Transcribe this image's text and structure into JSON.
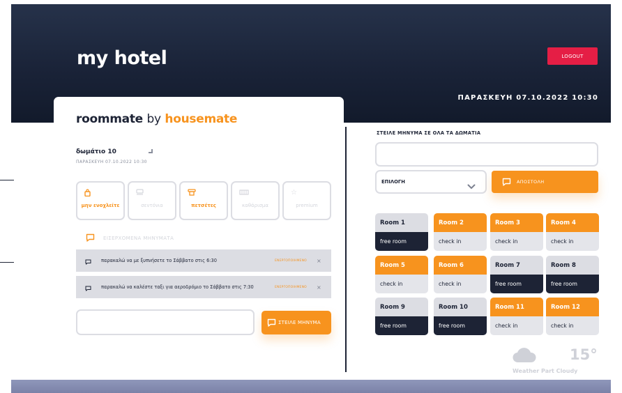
{
  "header": {
    "title": "my hotel",
    "logout_label": "LOGOUT",
    "datetime": "ΠΑΡΑΣΚΕΥΗ 07.10.2022 10:30"
  },
  "left": {
    "logo": {
      "part1": "roommate",
      "part2": "by",
      "part3": "housemate"
    },
    "room_title": "δωμάτιο 10",
    "room_date": "ΠΑΡΑΣΚΕΥΗ 07.10.2022 10:30",
    "services": [
      {
        "label": "μην ενοχλείτε",
        "icon": "bag-icon",
        "active": true
      },
      {
        "label": "σεντόνια",
        "icon": "bed-icon",
        "active": false
      },
      {
        "label": "πετσέτες",
        "icon": "towel-icon",
        "active": true
      },
      {
        "label": "καθάρισμα",
        "icon": "cleaning-icon",
        "active": false
      },
      {
        "label": "premium",
        "icon": "star-icon",
        "active": false
      }
    ],
    "inbox_label": "ΕΙΣΕΡΧΟΜΕΝΑ ΜΗΝΥΜΑΤΑ",
    "messages": [
      {
        "text": "παρακαλώ να με ξυπνήσετε το Σάββατο στις 6:30",
        "status": "ΕΝΕΡΓΟΠΟΙΗΜΕΝΟ",
        "close": "×"
      },
      {
        "text": "παρακαλώ να καλέστε ταξι για αεροδρόμιο το Σάββατο στις 7:30",
        "status": "ΕΝΕΡΓΟΠΟΙΗΜΕΝΟ",
        "close": "×"
      }
    ],
    "send_input_value": "",
    "send_label": "ΣΤΕΙΛΕ ΜΗΝΥΜΑ"
  },
  "right": {
    "broadcast_title": "ΣΤΕΙΛΕ ΜΗΝΥΜΑ ΣΕ ΟΛΑ ΤΑ ΔΩΜΑΤΙΑ",
    "broadcast_input_value": "",
    "select_label": "ΕΠΙΛΟΓΗ",
    "send_label": "ΑΠΟΣΤΟΛΗ",
    "rooms": [
      {
        "name": "Room 1",
        "status": "free room"
      },
      {
        "name": "Room 2",
        "status": "check in"
      },
      {
        "name": "Room 3",
        "status": "check in"
      },
      {
        "name": "Room 4",
        "status": "check in"
      },
      {
        "name": "Room 5",
        "status": "check in"
      },
      {
        "name": "Room 6",
        "status": "check in"
      },
      {
        "name": "Room 7",
        "status": "free room"
      },
      {
        "name": "Room 8",
        "status": "free room"
      },
      {
        "name": "Room 9",
        "status": "free room"
      },
      {
        "name": "Room 10",
        "status": "free room"
      },
      {
        "name": "Room 11",
        "status": "check in"
      },
      {
        "name": "Room 12",
        "status": "check in"
      }
    ]
  },
  "weather": {
    "temp": "15°",
    "condition": "Weather Part Cloudy",
    "icon": "cloud-icon"
  },
  "colors": {
    "navy": "#1d2335",
    "orange": "#f7931e",
    "red": "#e51e45",
    "light_gray": "#dcdde3",
    "footer": "#858cb0"
  }
}
